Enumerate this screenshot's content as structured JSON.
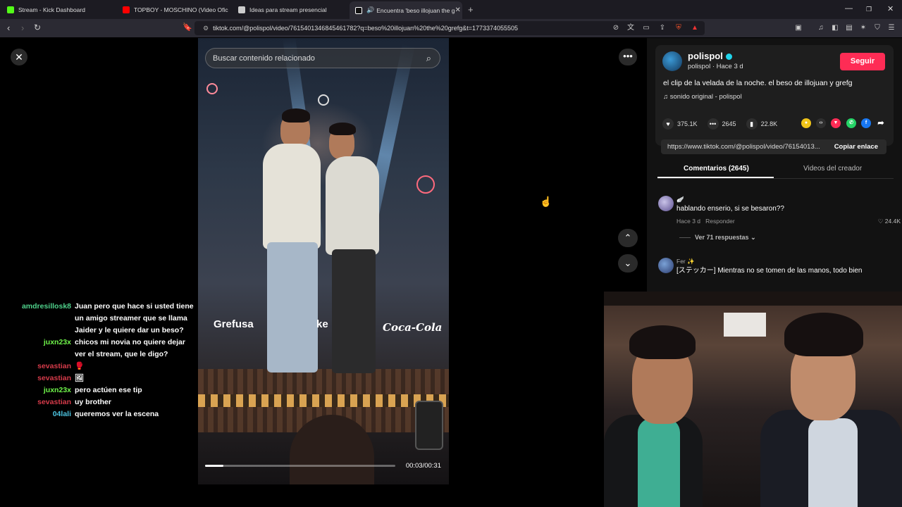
{
  "browser": {
    "tabs": [
      {
        "title": "Stream - Kick Dashboard",
        "favicon_color": "#53fc18"
      },
      {
        "title": "TOPBOY - MOSCHINO (Video Oficial)",
        "favicon_color": "#ff0000"
      },
      {
        "title": "Ideas para stream presencial",
        "favicon_color": "#cccccc"
      },
      {
        "title": "Encuentra 'beso illojuan the g",
        "favicon_color": "#ffffff"
      }
    ],
    "new_tab": "+",
    "url": "tiktok.com/@polispol/video/7615401346845461782?q=beso%20illojuan%20the%20grefg&t=1773374055505"
  },
  "video": {
    "search_placeholder": "Buscar contenido relacionado",
    "timecode": "00:03/00:31",
    "progress": 0.097,
    "brand_left": "Grefusa",
    "brand_mid": "ke",
    "brand_right": "Coca-Cola"
  },
  "chat": [
    {
      "user": "amdresillosk8",
      "color": "#4fd18b",
      "message": "Juan pero que hace si usted tiene un amigo streamer que se llama Jaider y le quiere dar un beso?"
    },
    {
      "user": "juxn23x",
      "color": "#6ff54a",
      "message": "chicos mi novia no quiere dejar ver el stream, que le digo?"
    },
    {
      "user": "sevastian",
      "color": "#d63b4a",
      "message": "🥊"
    },
    {
      "user": "sevastian",
      "color": "#d63b4a",
      "message": "🖼"
    },
    {
      "user": "juxn23x",
      "color": "#6ff54a",
      "message": "pero actúen ese tip"
    },
    {
      "user": "sevastian",
      "color": "#d63b4a",
      "message": "uy brother"
    },
    {
      "user": "04lali",
      "color": "#4cc3e0",
      "message": "queremos ver la escena"
    }
  ],
  "post": {
    "username": "polispol",
    "subline": "polispol · Hace 3 d",
    "follow_label": "Seguir",
    "description": "el clip de la velada de la noche. el beso de illojuan y grefg",
    "sound": "sonido original - polispol",
    "likes": "375.1K",
    "comments": "2645",
    "saves": "22.8K",
    "link": "https://www.tiktok.com/@polispol/video/76154013...",
    "copy_label": "Copiar enlace",
    "tab_comments": "Comentarios (2645)",
    "tab_creator": "Videos del creador"
  },
  "comments": [
    {
      "name": "🪽",
      "text": "hablando enserio, si se besaron??",
      "time": "Hace 3 d",
      "reply": "Responder",
      "likes": "24.4K",
      "replies_label": "Ver 71 respuestas"
    },
    {
      "name": "Fer ✨",
      "text": "[ステッカー] Mientras no se tomen de las manos, todo bien"
    }
  ],
  "accent": "#fe2c55"
}
